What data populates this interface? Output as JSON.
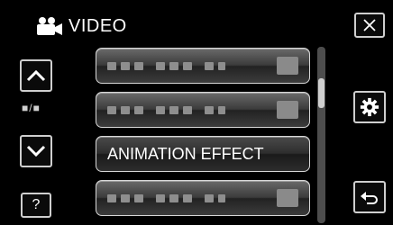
{
  "header": {
    "title": "VIDEO",
    "icon": "video-camera-icon"
  },
  "nav": {
    "page_indicator": "■/■",
    "up_icon": "chevron-up-icon",
    "down_icon": "chevron-down-icon",
    "help_label": "?"
  },
  "menu": {
    "items": [
      {
        "label": "",
        "value": ""
      },
      {
        "label": "",
        "value": ""
      },
      {
        "label": "ANIMATION EFFECT",
        "value": ""
      },
      {
        "label": "",
        "value": ""
      }
    ],
    "selected_index": 2
  },
  "right_buttons": {
    "close_icon": "close-icon",
    "settings_icon": "gear-icon",
    "back_icon": "return-arrow-icon"
  },
  "colors": {
    "background": "#000000",
    "button_border": "#cfcfcf",
    "item_gradient_top": "#6a6a6a",
    "item_gradient_bottom": "#222222"
  }
}
